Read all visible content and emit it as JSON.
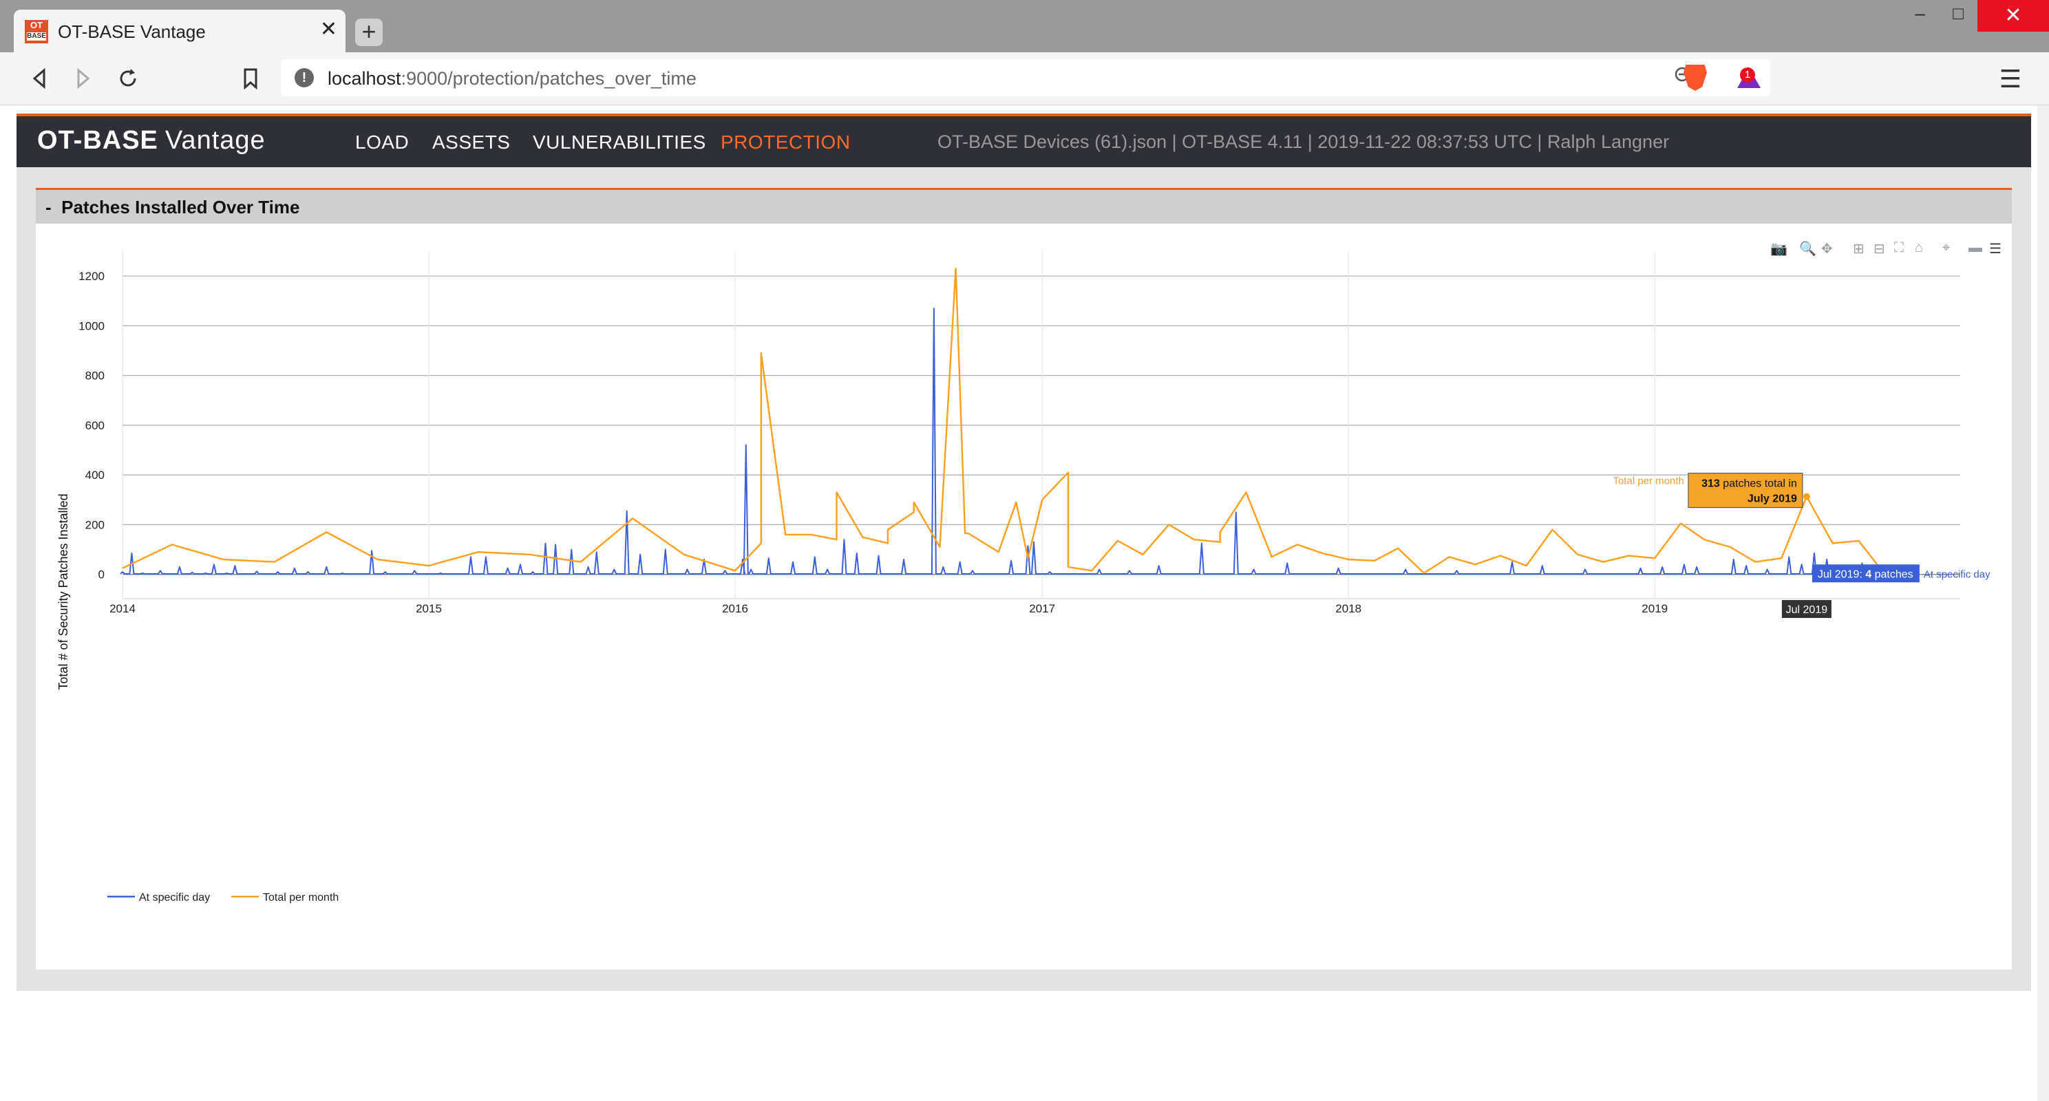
{
  "browser": {
    "tab_title": "OT-BASE Vantage",
    "tab_favicon_text": "OT",
    "tab_favicon_sub": "BASE",
    "tab_close": "✕",
    "new_tab": "+",
    "url_host": "localhost",
    "url_rest": ":9000/protection/patches_over_time",
    "rewards_badge": "1",
    "window_buttons": {
      "minimize": "–",
      "maximize": "□",
      "close": "✕"
    }
  },
  "app": {
    "brand_bold": "OT-BASE",
    "brand_light": "Vantage",
    "nav": [
      {
        "label": "LOAD",
        "active": false
      },
      {
        "label": "ASSETS",
        "active": false
      },
      {
        "label": "VULNERABILITIES",
        "active": false
      },
      {
        "label": "PROTECTION",
        "active": true
      }
    ],
    "info": "OT-BASE Devices (61).json | OT-BASE 4.11 | 2019-11-22 08:37:53 UTC | Ralph Langner",
    "accent_color": "#e95d1f",
    "nav_bg_color": "#2e2f37"
  },
  "panel": {
    "collapse_symbol": "-",
    "title": "Patches Installed Over Time"
  },
  "modebar_icons": [
    "camera-icon",
    "zoom-icon",
    "pan-icon",
    "zoom-in-icon",
    "zoom-out-icon",
    "autoscale-icon",
    "reset-axes-icon",
    "spike-lines-icon",
    "hover-closest-icon",
    "hover-compare-icon"
  ],
  "chart_data": {
    "type": "line",
    "ylabel": "Total # of Security Patches Installed",
    "xlabel": "",
    "x_ticks": [
      "2014",
      "2015",
      "2016",
      "2017",
      "2018",
      "2019"
    ],
    "y_ticks": [
      0,
      200,
      400,
      600,
      800,
      1000,
      1200
    ],
    "ylim": [
      -70,
      1300
    ],
    "xlim": [
      "2014-01-01",
      "2019-12-31"
    ],
    "grid": true,
    "legend_position": "bottom-left",
    "series": [
      {
        "name": "At specific day",
        "color": "#3a5fd9",
        "points": [
          [
            "2014-01-01",
            10
          ],
          [
            "2014-01-12",
            85
          ],
          [
            "2014-01-25",
            5
          ],
          [
            "2014-02-15",
            15
          ],
          [
            "2014-03-10",
            30
          ],
          [
            "2014-03-25",
            8
          ],
          [
            "2014-04-10",
            5
          ],
          [
            "2014-04-20",
            40
          ],
          [
            "2014-05-05",
            5
          ],
          [
            "2014-05-15",
            35
          ],
          [
            "2014-06-10",
            12
          ],
          [
            "2014-07-05",
            10
          ],
          [
            "2014-07-25",
            25
          ],
          [
            "2014-08-10",
            10
          ],
          [
            "2014-09-01",
            30
          ],
          [
            "2014-09-20",
            5
          ],
          [
            "2014-10-25",
            95
          ],
          [
            "2014-11-10",
            10
          ],
          [
            "2014-12-15",
            15
          ],
          [
            "2015-01-15",
            5
          ],
          [
            "2015-02-20",
            70
          ],
          [
            "2015-03-10",
            70
          ],
          [
            "2015-04-05",
            25
          ],
          [
            "2015-04-20",
            40
          ],
          [
            "2015-05-05",
            10
          ],
          [
            "2015-05-20",
            125
          ],
          [
            "2015-06-01",
            120
          ],
          [
            "2015-06-20",
            100
          ],
          [
            "2015-07-10",
            30
          ],
          [
            "2015-07-20",
            90
          ],
          [
            "2015-08-10",
            20
          ],
          [
            "2015-08-25",
            255
          ],
          [
            "2015-09-10",
            80
          ],
          [
            "2015-10-10",
            100
          ],
          [
            "2015-11-05",
            20
          ],
          [
            "2015-11-25",
            60
          ],
          [
            "2015-12-20",
            15
          ],
          [
            "2016-01-10",
            60
          ],
          [
            "2016-01-14",
            520
          ],
          [
            "2016-01-20",
            20
          ],
          [
            "2016-02-10",
            65
          ],
          [
            "2016-03-10",
            50
          ],
          [
            "2016-04-05",
            70
          ],
          [
            "2016-04-20",
            20
          ],
          [
            "2016-05-10",
            140
          ],
          [
            "2016-05-25",
            85
          ],
          [
            "2016-06-20",
            75
          ],
          [
            "2016-07-20",
            60
          ],
          [
            "2016-08-25",
            1070
          ],
          [
            "2016-09-05",
            30
          ],
          [
            "2016-09-25",
            50
          ],
          [
            "2016-10-10",
            15
          ],
          [
            "2016-11-25",
            55
          ],
          [
            "2016-12-15",
            115
          ],
          [
            "2016-12-22",
            130
          ],
          [
            "2017-01-10",
            10
          ],
          [
            "2017-03-10",
            20
          ],
          [
            "2017-04-15",
            15
          ],
          [
            "2017-05-20",
            35
          ],
          [
            "2017-07-10",
            125
          ],
          [
            "2017-08-20",
            250
          ],
          [
            "2017-09-10",
            20
          ],
          [
            "2017-10-20",
            45
          ],
          [
            "2017-12-20",
            25
          ],
          [
            "2018-03-10",
            20
          ],
          [
            "2018-05-10",
            15
          ],
          [
            "2018-07-15",
            50
          ],
          [
            "2018-08-20",
            35
          ],
          [
            "2018-10-10",
            20
          ],
          [
            "2018-12-15",
            25
          ],
          [
            "2019-01-10",
            30
          ],
          [
            "2019-02-05",
            40
          ],
          [
            "2019-02-20",
            30
          ],
          [
            "2019-04-05",
            60
          ],
          [
            "2019-04-20",
            35
          ],
          [
            "2019-05-15",
            20
          ],
          [
            "2019-06-10",
            70
          ],
          [
            "2019-06-25",
            40
          ],
          [
            "2019-07-10",
            85
          ],
          [
            "2019-07-25",
            60
          ],
          [
            "2019-08-15",
            30
          ],
          [
            "2019-09-05",
            45
          ],
          [
            "2019-10-01",
            5
          ]
        ]
      },
      {
        "name": "Total per month",
        "color": "#ff9f1a",
        "points": [
          [
            "2014-01-01",
            25
          ],
          [
            "2014-03-01",
            120
          ],
          [
            "2014-05-01",
            60
          ],
          [
            "2014-07-01",
            50
          ],
          [
            "2014-09-01",
            170
          ],
          [
            "2014-11-01",
            60
          ],
          [
            "2015-01-01",
            35
          ],
          [
            "2015-03-01",
            90
          ],
          [
            "2015-05-01",
            80
          ],
          [
            "2015-07-01",
            50
          ],
          [
            "2015-09-01",
            225
          ],
          [
            "2015-11-01",
            80
          ],
          [
            "2016-01-01",
            15
          ],
          [
            "2016-02-01",
            125
          ],
          [
            "2016-04-01",
            160
          ],
          [
            "2016-05-01",
            140
          ],
          [
            "2016-07-01",
            125
          ],
          [
            "2016-08-01",
            250
          ],
          [
            "2016-10-01",
            165
          ],
          [
            "2016-12-01",
            290
          ],
          [
            "2017-02-01",
            410
          ],
          [
            "2017-04-01",
            135
          ],
          [
            "2017-06-01",
            200
          ],
          [
            "2017-08-01",
            130
          ],
          [
            "2017-10-01",
            75
          ],
          [
            "2016-02-01",
            890
          ],
          [
            "2016-03-01",
            160
          ],
          [
            "2016-05-01",
            330
          ],
          [
            "2016-06-01",
            150
          ],
          [
            "2016-07-01",
            180
          ],
          [
            "2016-08-01",
            290
          ],
          [
            "2016-09-01",
            110
          ],
          [
            "2016-09-20",
            1230
          ],
          [
            "2016-10-05",
            165
          ],
          [
            "2016-11-10",
            90
          ],
          [
            "2016-12-15",
            65
          ],
          [
            "2017-01-01",
            300
          ],
          [
            "2017-02-01",
            30
          ],
          [
            "2017-03-01",
            15
          ],
          [
            "2017-05-01",
            80
          ],
          [
            "2017-07-01",
            140
          ],
          [
            "2017-08-01",
            170
          ],
          [
            "2017-09-01",
            330
          ],
          [
            "2017-10-01",
            70
          ],
          [
            "2017-11-01",
            120
          ],
          [
            "2017-12-01",
            85
          ],
          [
            "2018-01-01",
            60
          ],
          [
            "2018-02-01",
            55
          ],
          [
            "2018-03-01",
            105
          ],
          [
            "2018-04-01",
            5
          ],
          [
            "2018-05-01",
            70
          ],
          [
            "2018-06-01",
            40
          ],
          [
            "2018-07-01",
            75
          ],
          [
            "2018-08-01",
            35
          ],
          [
            "2018-09-01",
            180
          ],
          [
            "2018-10-01",
            80
          ],
          [
            "2018-11-01",
            50
          ],
          [
            "2018-12-01",
            75
          ],
          [
            "2019-01-01",
            65
          ],
          [
            "2019-02-01",
            205
          ],
          [
            "2019-03-01",
            140
          ],
          [
            "2019-04-01",
            110
          ],
          [
            "2019-05-01",
            50
          ],
          [
            "2019-06-01",
            65
          ],
          [
            "2019-07-01",
            313
          ],
          [
            "2019-08-01",
            125
          ],
          [
            "2019-09-01",
            135
          ],
          [
            "2019-10-01",
            5
          ]
        ]
      }
    ],
    "hover": {
      "x_label": "Jul 2019",
      "orange_name": "Total per month",
      "orange_value": "313",
      "orange_text": " patches total in",
      "orange_month": "July 2019",
      "blue_name": "At specific day",
      "blue_text": "Jul 2019: ",
      "blue_value": "4",
      "blue_suffix": " patches"
    }
  }
}
